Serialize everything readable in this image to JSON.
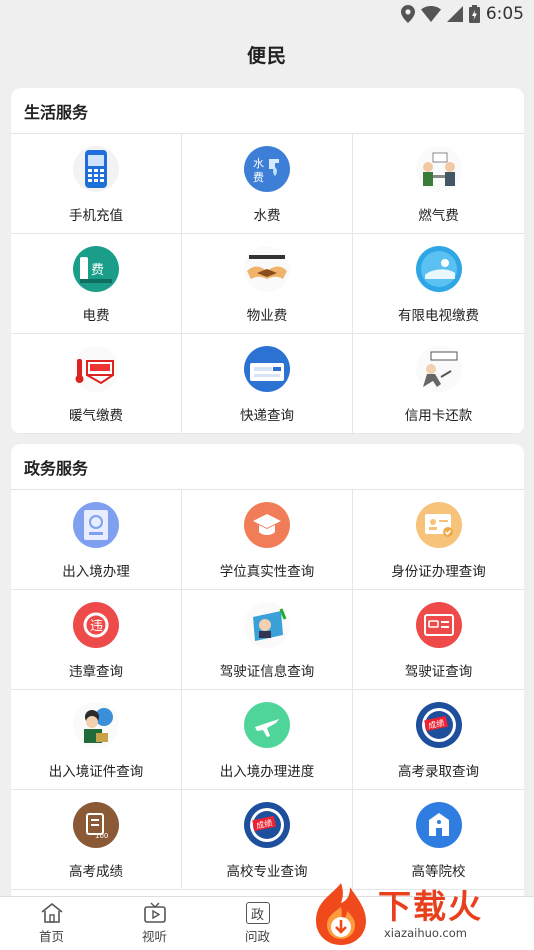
{
  "status": {
    "time": "6:05"
  },
  "header": {
    "title": "便民"
  },
  "life": {
    "title": "生活服务",
    "items": [
      {
        "label": "手机充值",
        "icon": "phone-recharge-icon"
      },
      {
        "label": "水费",
        "icon": "water-fee-icon"
      },
      {
        "label": "燃气费",
        "icon": "gas-fee-icon"
      },
      {
        "label": "电费",
        "icon": "electric-fee-icon"
      },
      {
        "label": "物业费",
        "icon": "property-fee-icon"
      },
      {
        "label": "有限电视缴费",
        "icon": "cable-tv-icon"
      },
      {
        "label": "暖气缴费",
        "icon": "heating-fee-icon"
      },
      {
        "label": "快递查询",
        "icon": "express-query-icon"
      },
      {
        "label": "信用卡还款",
        "icon": "credit-card-icon"
      }
    ]
  },
  "gov": {
    "title": "政务服务",
    "items": [
      {
        "label": "出入境办理",
        "icon": "passport-icon"
      },
      {
        "label": "学位真实性查询",
        "icon": "graduation-cap-icon"
      },
      {
        "label": "身份证办理查询",
        "icon": "id-card-icon"
      },
      {
        "label": "违章查询",
        "icon": "violation-icon"
      },
      {
        "label": "驾驶证信息查询",
        "icon": "driver-info-icon"
      },
      {
        "label": "驾驶证查询",
        "icon": "driver-license-icon"
      },
      {
        "label": "出入境证件查询",
        "icon": "document-query-icon"
      },
      {
        "label": "出入境办理进度",
        "icon": "airplane-icon"
      },
      {
        "label": "高考录取查询",
        "icon": "admission-icon"
      },
      {
        "label": "高考成绩",
        "icon": "score-icon"
      },
      {
        "label": "高校专业查询",
        "icon": "major-query-icon"
      },
      {
        "label": "高等院校",
        "icon": "university-icon"
      }
    ]
  },
  "tabs": [
    {
      "label": "首页",
      "icon": "home-icon"
    },
    {
      "label": "视听",
      "icon": "tv-icon"
    },
    {
      "label": "问政",
      "icon": "gov-icon",
      "glyph": "政"
    }
  ],
  "watermark": {
    "cn": "下载火",
    "en": "xiazaihuo.com"
  }
}
